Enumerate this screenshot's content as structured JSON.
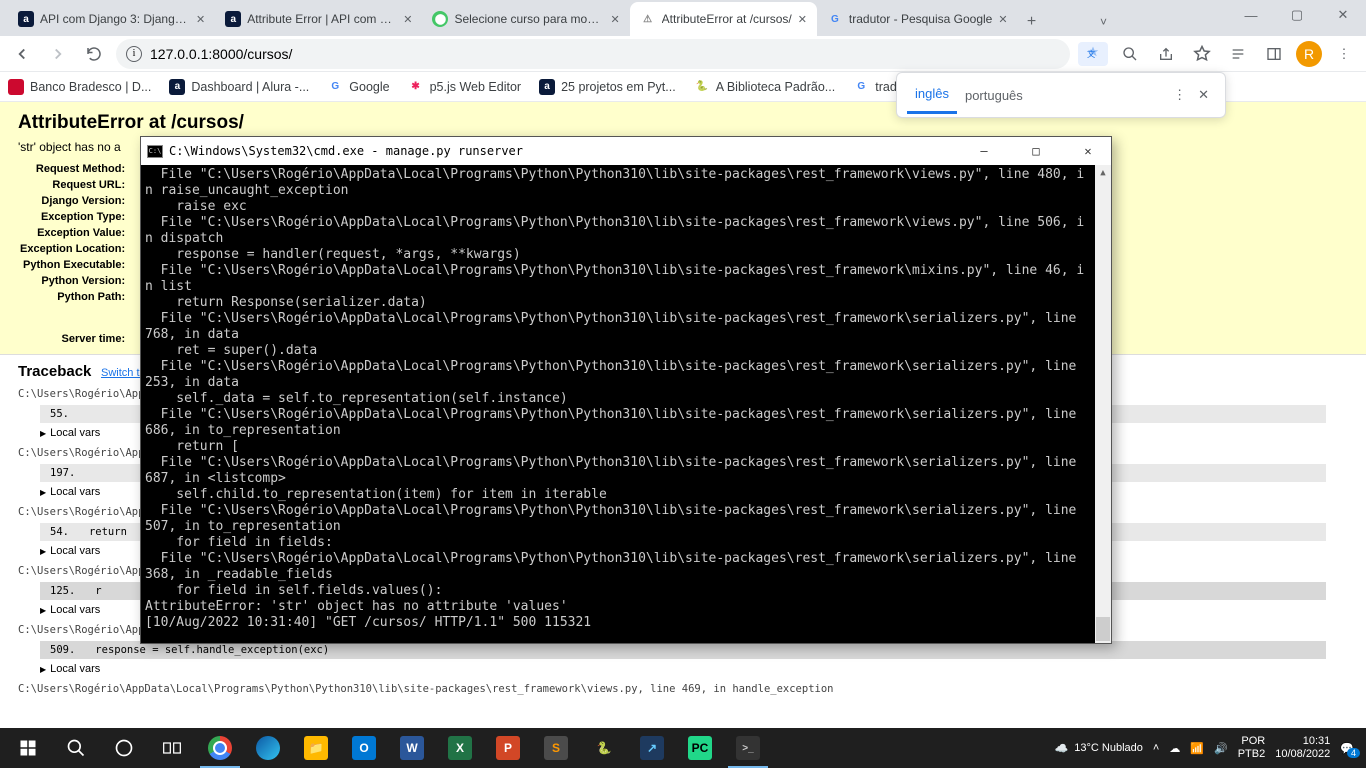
{
  "tabs": [
    {
      "title": "API com Django 3: Django R",
      "icon_bg": "#0a1a3a",
      "icon_text": "a",
      "active": false
    },
    {
      "title": "Attribute Error | API com Dja",
      "icon_bg": "#0a1a3a",
      "icon_text": "a",
      "active": false
    },
    {
      "title": "Selecione curso para modific",
      "icon_bg": "#2b8a3e",
      "icon_text": "⬢",
      "active": false
    },
    {
      "title": "AttributeError at /cursos/",
      "icon_bg": "#ffffff",
      "icon_text": "⚠",
      "active": true
    },
    {
      "title": "tradutor - Pesquisa Google",
      "icon_bg": "#ffffff",
      "icon_text": "G",
      "active": false
    }
  ],
  "address": "127.0.0.1:8000/cursos/",
  "avatar_letter": "R",
  "bookmarks": [
    {
      "label": "Banco Bradesco | D...",
      "icon_bg": "#cc092f",
      "icon_text": ""
    },
    {
      "label": "Dashboard | Alura -...",
      "icon_bg": "#0a1a3a",
      "icon_text": "a"
    },
    {
      "label": "Google",
      "icon_bg": "#fff",
      "icon_text": "G"
    },
    {
      "label": "p5.js Web Editor",
      "icon_bg": "#fff",
      "icon_text": "✱"
    },
    {
      "label": "25 projetos em Pyt...",
      "icon_bg": "#0a1a3a",
      "icon_text": "a"
    },
    {
      "label": "A Biblioteca Padrão...",
      "icon_bg": "#fff",
      "icon_text": "🐍"
    },
    {
      "label": "tradut",
      "icon_bg": "#fff",
      "icon_text": "G"
    }
  ],
  "translate": {
    "lang_src": "inglês",
    "lang_dst": "português"
  },
  "django": {
    "title": "AttributeError at /cursos/",
    "errline": "'str' object has no a",
    "meta_labels": {
      "method": "Request Method:",
      "url": "Request URL:",
      "dversion": "Django Version:",
      "etype": "Exception Type:",
      "evalue": "Exception Value:",
      "eloc": "Exception Location:",
      "pyexe": "Python Executable:",
      "pyver": "Python Version:",
      "pypath": "Python Path:",
      "stime": "Server time:"
    },
    "traceback_title": "Traceback",
    "switch_label": "Switch to c",
    "local_vars": "Local vars",
    "frames": [
      {
        "path": "C:\\Users\\Rogério\\AppData\\Loc",
        "line": "55."
      },
      {
        "path": "C:\\Users\\Rogério\\AppData\\Loc",
        "line": "197."
      },
      {
        "path": "C:\\Users\\Rogério\\AppData\\Loc",
        "line": "54.",
        "code": "return"
      },
      {
        "path": "C:\\Users\\Rogério\\AppData\\Loc",
        "line": "125.",
        "code": "r"
      },
      {
        "path": "C:\\Users\\Rogério\\AppData\\Local\\Programs\\Python\\Python310\\lib\\site-packages\\rest_framework\\views.py, line 506, in dispatch",
        "line": "509.",
        "code": "response = self.handle_exception(exc)"
      },
      {
        "path": "C:\\Users\\Rogério\\AppData\\Local\\Programs\\Python\\Python310\\lib\\site-packages\\rest_framework\\views.py, line 469, in handle_exception"
      }
    ]
  },
  "cmd": {
    "title": "C:\\Windows\\System32\\cmd.exe - manage.py  runserver",
    "lines": [
      "  File \"C:\\Users\\Rogério\\AppData\\Local\\Programs\\Python\\Python310\\lib\\site-packages\\rest_framework\\views.py\", line 480, i",
      "n raise_uncaught_exception",
      "    raise exc",
      "  File \"C:\\Users\\Rogério\\AppData\\Local\\Programs\\Python\\Python310\\lib\\site-packages\\rest_framework\\views.py\", line 506, i",
      "n dispatch",
      "    response = handler(request, *args, **kwargs)",
      "  File \"C:\\Users\\Rogério\\AppData\\Local\\Programs\\Python\\Python310\\lib\\site-packages\\rest_framework\\mixins.py\", line 46, i",
      "n list",
      "    return Response(serializer.data)",
      "  File \"C:\\Users\\Rogério\\AppData\\Local\\Programs\\Python\\Python310\\lib\\site-packages\\rest_framework\\serializers.py\", line ",
      "768, in data",
      "    ret = super().data",
      "  File \"C:\\Users\\Rogério\\AppData\\Local\\Programs\\Python\\Python310\\lib\\site-packages\\rest_framework\\serializers.py\", line ",
      "253, in data",
      "    self._data = self.to_representation(self.instance)",
      "  File \"C:\\Users\\Rogério\\AppData\\Local\\Programs\\Python\\Python310\\lib\\site-packages\\rest_framework\\serializers.py\", line ",
      "686, in to_representation",
      "    return [",
      "  File \"C:\\Users\\Rogério\\AppData\\Local\\Programs\\Python\\Python310\\lib\\site-packages\\rest_framework\\serializers.py\", line ",
      "687, in <listcomp>",
      "    self.child.to_representation(item) for item in iterable",
      "  File \"C:\\Users\\Rogério\\AppData\\Local\\Programs\\Python\\Python310\\lib\\site-packages\\rest_framework\\serializers.py\", line ",
      "507, in to_representation",
      "    for field in fields:",
      "  File \"C:\\Users\\Rogério\\AppData\\Local\\Programs\\Python\\Python310\\lib\\site-packages\\rest_framework\\serializers.py\", line ",
      "368, in _readable_fields",
      "    for field in self.fields.values():",
      "AttributeError: 'str' object has no attribute 'values'",
      "[10/Aug/2022 10:31:40] \"GET /cursos/ HTTP/1.1\" 500 115321"
    ]
  },
  "taskbar": {
    "weather": "13°C  Nublado",
    "lang": "POR\nPTB2",
    "time": "10:31",
    "date": "10/08/2022",
    "notif_count": "4"
  }
}
